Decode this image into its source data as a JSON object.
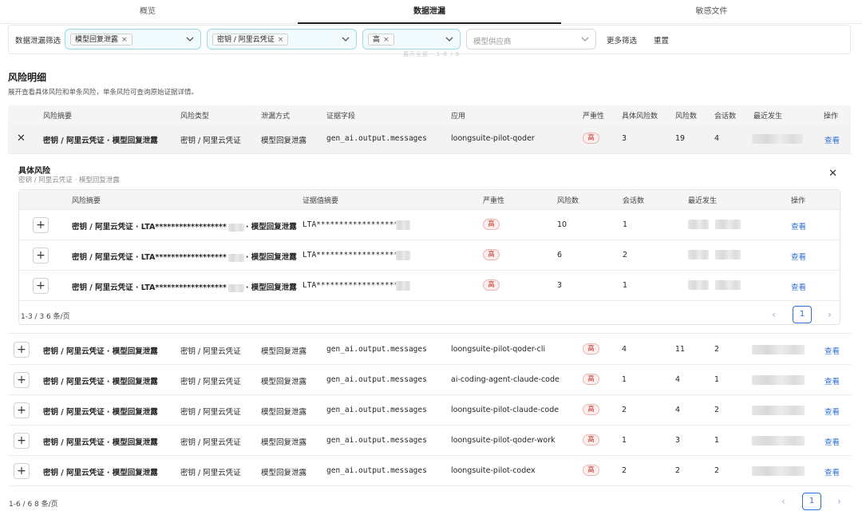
{
  "tabs": [
    "概览",
    "数据泄漏",
    "敏感文件"
  ],
  "filters": {
    "label": "数据泄漏筛选",
    "chip1": "模型回复泄露",
    "chip2": "密钥 / 阿里云凭证",
    "chip3": "高",
    "vendor_placeholder": "模型供应商",
    "more": "更多筛选",
    "reset": "重置"
  },
  "ghost_text": "展开全部 · 1-6 / 6",
  "section": {
    "title": "风险明细",
    "desc": "展开查看具体风险和单条风险，单条风险可查询原始证据详情。"
  },
  "columns": [
    "风险摘要",
    "风险类型",
    "泄漏方式",
    "证据字段",
    "应用",
    "严重性",
    "具体风险数",
    "风险数",
    "会话数",
    "最近发生",
    "操作"
  ],
  "rows": [
    {
      "summary": "密钥 / 阿里云凭证 · 模型回复泄露",
      "type": "密钥 / 阿里云凭证",
      "leak": "模型回复泄露",
      "field": "gen_ai.output.messages",
      "app": "loongsuite-pilot-qoder",
      "severity": "高",
      "specific": "3",
      "risks": "19",
      "sessions": "4",
      "action": "查看"
    },
    {
      "summary": "密钥 / 阿里云凭证 · 模型回复泄露",
      "type": "密钥 / 阿里云凭证",
      "leak": "模型回复泄露",
      "field": "gen_ai.output.messages",
      "app": "loongsuite-pilot-qoder-cli",
      "severity": "高",
      "specific": "4",
      "risks": "11",
      "sessions": "2",
      "action": "查看"
    },
    {
      "summary": "密钥 / 阿里云凭证 · 模型回复泄露",
      "type": "密钥 / 阿里云凭证",
      "leak": "模型回复泄露",
      "field": "gen_ai.output.messages",
      "app": "ai-coding-agent-claude-code",
      "severity": "高",
      "specific": "1",
      "risks": "4",
      "sessions": "1",
      "action": "查看"
    },
    {
      "summary": "密钥 / 阿里云凭证 · 模型回复泄露",
      "type": "密钥 / 阿里云凭证",
      "leak": "模型回复泄露",
      "field": "gen_ai.output.messages",
      "app": "loongsuite-pilot-claude-code",
      "severity": "高",
      "specific": "2",
      "risks": "4",
      "sessions": "2",
      "action": "查看"
    },
    {
      "summary": "密钥 / 阿里云凭证 · 模型回复泄露",
      "type": "密钥 / 阿里云凭证",
      "leak": "模型回复泄露",
      "field": "gen_ai.output.messages",
      "app": "loongsuite-pilot-qoder-work",
      "severity": "高",
      "specific": "1",
      "risks": "3",
      "sessions": "1",
      "action": "查看"
    },
    {
      "summary": "密钥 / 阿里云凭证 · 模型回复泄露",
      "type": "密钥 / 阿里云凭证",
      "leak": "模型回复泄露",
      "field": "gen_ai.output.messages",
      "app": "loongsuite-pilot-codex",
      "severity": "高",
      "specific": "2",
      "risks": "2",
      "sessions": "2",
      "action": "查看"
    }
  ],
  "detail": {
    "title": "具体风险",
    "subtitle": "密钥 / 阿里云凭证 · 模型回复泄露",
    "columns": [
      "风险摘要",
      "证据值摘要",
      "严重性",
      "风险数",
      "会话数",
      "最近发生",
      "操作"
    ],
    "rows": [
      {
        "summary_a": "密钥 / 阿里云凭证 · LTA******************",
        "summary_b": "· 模型回复泄露",
        "evidence": "LTA******************",
        "severity": "高",
        "risks": "10",
        "sessions": "1",
        "action": "查看"
      },
      {
        "summary_a": "密钥 / 阿里云凭证 · LTA******************",
        "summary_b": "· 模型回复泄露",
        "evidence": "LTA******************",
        "severity": "高",
        "risks": "6",
        "sessions": "2",
        "action": "查看"
      },
      {
        "summary_a": "密钥 / 阿里云凭证 · LTA******************",
        "summary_b": "· 模型回复泄露",
        "evidence": "LTA******************",
        "severity": "高",
        "risks": "3",
        "sessions": "1",
        "action": "查看"
      }
    ],
    "pagination": {
      "info": "1-3 / 3  6 条/页",
      "current": "1"
    }
  },
  "pagination": {
    "info": "1-6 / 6  8 条/页",
    "current": "1"
  },
  "icons": {
    "expand": "plus-icon",
    "collapse": "close-icon",
    "prev": "chevron-left-icon",
    "next": "chevron-right-icon"
  }
}
